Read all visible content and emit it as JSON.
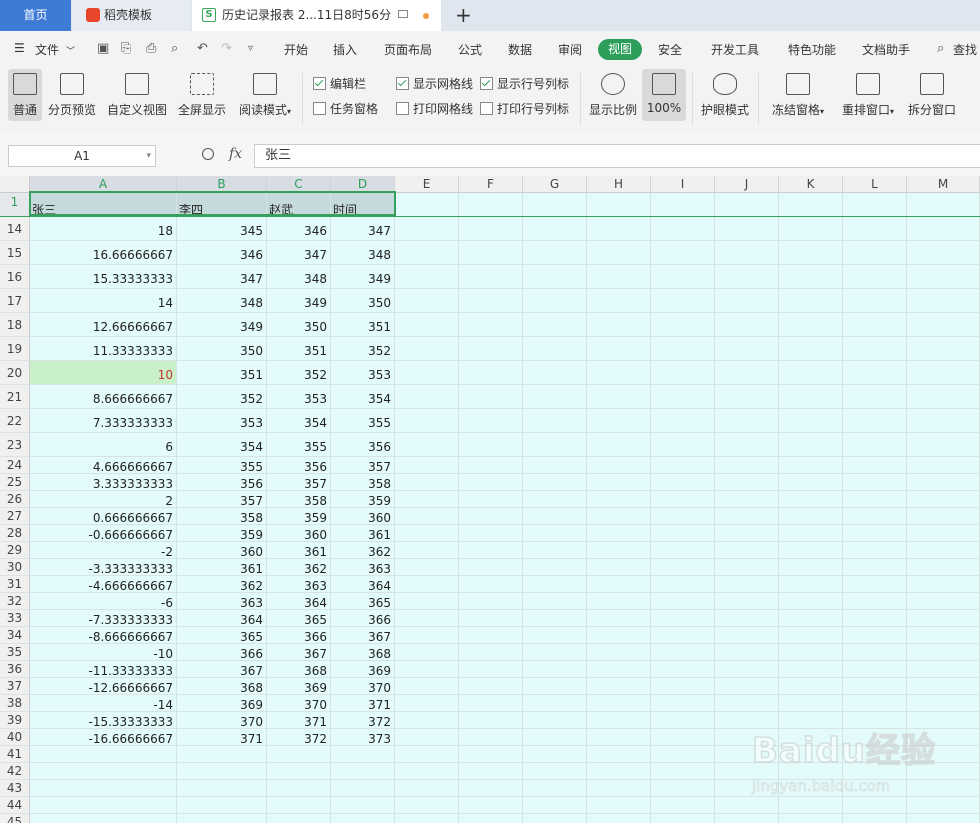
{
  "tabs": {
    "home": "首页",
    "template": "稻壳模板",
    "document": "历史记录报表 2...11日8时56分",
    "new_tab": "+"
  },
  "menu": {
    "file": "文件",
    "items": [
      "开始",
      "插入",
      "页面布局",
      "公式",
      "数据",
      "审阅",
      "视图",
      "安全",
      "开发工具",
      "特色功能",
      "文档助手",
      "查找"
    ],
    "active": "视图"
  },
  "ribbon": {
    "buttons": [
      "普通",
      "分页预览",
      "自定义视图",
      "全屏显示",
      "阅读模式",
      "显示比例",
      "100%",
      "护眼模式",
      "冻结窗格",
      "重排窗口",
      "拆分窗口"
    ],
    "checkboxes": [
      {
        "label": "编辑栏",
        "checked": true
      },
      {
        "label": "任务窗格",
        "checked": false
      },
      {
        "label": "显示网格线",
        "checked": true
      },
      {
        "label": "打印网格线",
        "checked": false
      },
      {
        "label": "显示行号列标",
        "checked": true
      },
      {
        "label": "打印行号列标",
        "checked": false
      }
    ]
  },
  "formula_bar": {
    "cell_ref": "A1",
    "fx": "fx",
    "value": "张三"
  },
  "sheet": {
    "columns": [
      "A",
      "B",
      "C",
      "D",
      "E",
      "F",
      "G",
      "H",
      "I",
      "J",
      "K",
      "L",
      "M"
    ],
    "header_row": {
      "row": "1",
      "cells": [
        "张三",
        "李四",
        "赵武",
        "时间"
      ]
    },
    "rows": [
      {
        "row": "14",
        "cells": [
          "18",
          "345",
          "346",
          "347"
        ]
      },
      {
        "row": "15",
        "cells": [
          "16.66666667",
          "346",
          "347",
          "348"
        ]
      },
      {
        "row": "16",
        "cells": [
          "15.33333333",
          "347",
          "348",
          "349"
        ]
      },
      {
        "row": "17",
        "cells": [
          "14",
          "348",
          "349",
          "350"
        ]
      },
      {
        "row": "18",
        "cells": [
          "12.66666667",
          "349",
          "350",
          "351"
        ]
      },
      {
        "row": "19",
        "cells": [
          "11.33333333",
          "350",
          "351",
          "352"
        ]
      },
      {
        "row": "20",
        "cells": [
          "10",
          "351",
          "352",
          "353"
        ]
      },
      {
        "row": "21",
        "cells": [
          "8.666666667",
          "352",
          "353",
          "354"
        ]
      },
      {
        "row": "22",
        "cells": [
          "7.333333333",
          "353",
          "354",
          "355"
        ]
      },
      {
        "row": "23",
        "cells": [
          "6",
          "354",
          "355",
          "356"
        ]
      },
      {
        "row": "24",
        "cells": [
          "4.666666667",
          "355",
          "356",
          "357"
        ]
      },
      {
        "row": "25",
        "cells": [
          "3.333333333",
          "356",
          "357",
          "358"
        ]
      },
      {
        "row": "26",
        "cells": [
          "2",
          "357",
          "358",
          "359"
        ]
      },
      {
        "row": "27",
        "cells": [
          "0.666666667",
          "358",
          "359",
          "360"
        ]
      },
      {
        "row": "28",
        "cells": [
          "-0.666666667",
          "359",
          "360",
          "361"
        ]
      },
      {
        "row": "29",
        "cells": [
          "-2",
          "360",
          "361",
          "362"
        ]
      },
      {
        "row": "30",
        "cells": [
          "-3.333333333",
          "361",
          "362",
          "363"
        ]
      },
      {
        "row": "31",
        "cells": [
          "-4.666666667",
          "362",
          "363",
          "364"
        ]
      },
      {
        "row": "32",
        "cells": [
          "-6",
          "363",
          "364",
          "365"
        ]
      },
      {
        "row": "33",
        "cells": [
          "-7.333333333",
          "364",
          "365",
          "366"
        ]
      },
      {
        "row": "34",
        "cells": [
          "-8.666666667",
          "365",
          "366",
          "367"
        ]
      },
      {
        "row": "35",
        "cells": [
          "-10",
          "366",
          "367",
          "368"
        ]
      },
      {
        "row": "36",
        "cells": [
          "-11.33333333",
          "367",
          "368",
          "369"
        ]
      },
      {
        "row": "37",
        "cells": [
          "-12.66666667",
          "368",
          "369",
          "370"
        ]
      },
      {
        "row": "38",
        "cells": [
          "-14",
          "369",
          "370",
          "371"
        ]
      },
      {
        "row": "39",
        "cells": [
          "-15.33333333",
          "370",
          "371",
          "372"
        ]
      },
      {
        "row": "40",
        "cells": [
          "-16.66666667",
          "371",
          "372",
          "373"
        ]
      },
      {
        "row": "41",
        "cells": [
          "",
          "",
          "",
          ""
        ]
      },
      {
        "row": "42",
        "cells": [
          "",
          "",
          "",
          ""
        ]
      },
      {
        "row": "43",
        "cells": [
          "",
          "",
          "",
          ""
        ]
      },
      {
        "row": "44",
        "cells": [
          "",
          "",
          "",
          ""
        ]
      },
      {
        "row": "45",
        "cells": [
          "",
          "",
          "",
          ""
        ]
      }
    ],
    "highlighted_row": "20"
  },
  "watermark": {
    "brand": "Baidu经验",
    "url": "jingyan.baidu.com"
  },
  "colors": {
    "accent": "#2d9e5a",
    "home_tab": "#3d7bd6",
    "sheet_bg": "#e3fbfb",
    "highlight_cell": "#c9f0c9",
    "highlight_text": "#c0392b"
  }
}
